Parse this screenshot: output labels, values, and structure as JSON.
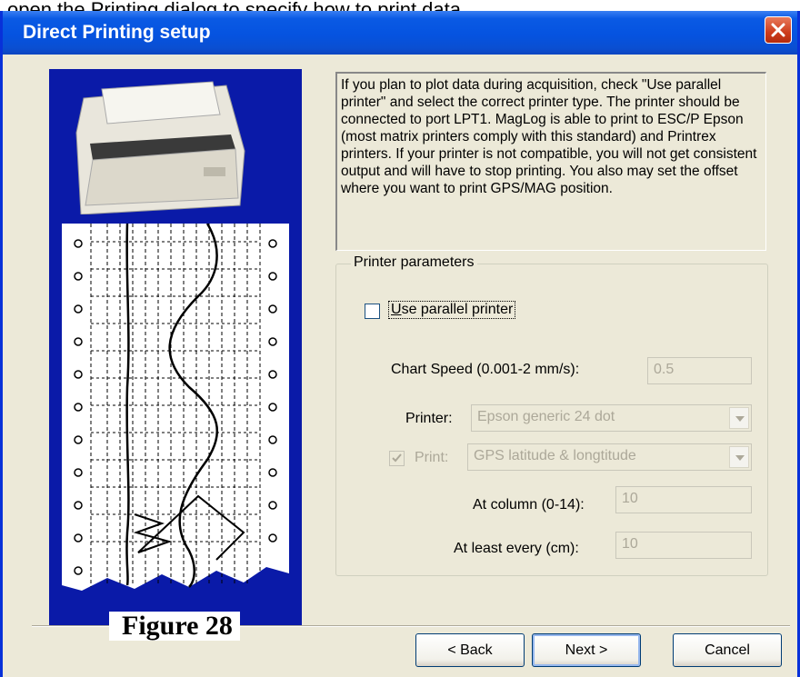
{
  "document": {
    "top_text": "open the Printing dialog to specify how to print data",
    "figure_caption": "Figure 28"
  },
  "window": {
    "title": "Direct Printing setup",
    "close_icon": "close-icon"
  },
  "help_text": "If you plan to plot data during acquisition, check \"Use parallel printer\" and select the correct printer type. The printer should be connected to port LPT1. MagLog is able to print to ESC/P Epson (most matrix printers comply with this standard) and Printrex printers. If your printer is not compatible, you will not get consistent output and will have to stop printing. You also may set the offset where you want to print GPS/MAG position.",
  "printer_parameters": {
    "group_label": "Printer parameters",
    "use_parallel": {
      "label": "Use parallel printer",
      "checked": false
    },
    "chart_speed": {
      "label": "Chart Speed (0.001-2 mm/s):",
      "value": "0.5"
    },
    "printer": {
      "label": "Printer:",
      "value": "Epson generic 24 dot"
    },
    "print": {
      "label": "Print:",
      "checked": true,
      "value": "GPS latitude & longtitude"
    },
    "at_column": {
      "label": "At column (0-14):",
      "value": "10"
    },
    "at_least_every": {
      "label": "At least every (cm):",
      "value": "10"
    }
  },
  "buttons": {
    "back": "< Back",
    "next": "Next >",
    "cancel": "Cancel"
  },
  "colors": {
    "titlebar": "#0553e0",
    "art_background": "#0a1aa8",
    "dialog_background": "#ece9d8"
  }
}
